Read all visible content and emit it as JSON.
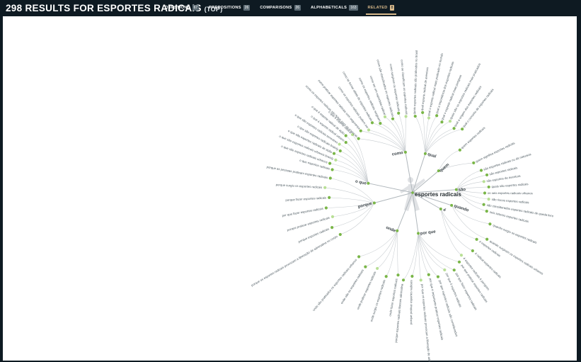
{
  "header": {
    "count": "298",
    "title_text": "RESULTS FOR ESPORTES RADICAIS",
    "top_label": "(TOP)"
  },
  "tabs": [
    {
      "label": "QUESTIONS",
      "count": "67",
      "active": false
    },
    {
      "label": "PREPOSITIONS",
      "count": "26",
      "active": false
    },
    {
      "label": "COMPARISONS",
      "count": "26",
      "active": false
    },
    {
      "label": "ALPHABETICALS",
      "count": "163",
      "active": false
    },
    {
      "label": "RELATED",
      "count": "8",
      "active": true
    }
  ],
  "colors": {
    "dark_bg": "#0e1a22",
    "accent": "#d7b88a",
    "dot_green": "#7ab648",
    "dot_light": "#b8df95"
  },
  "wheel": {
    "center_label": "esportes radicais",
    "center_icon": "person-silhouette-icon",
    "branches": [
      {
        "label": "como",
        "items": [
          "como os esportes radicais são feitos para as crianças",
          "como praticar esportes radicais com segurança",
          "como os esportes radicais podem ser",
          "como se tornar atleta de esportes radicais",
          "como os esportes radicais surgiram",
          "como ser um esportista radical",
          "como são classificados os esportes radicais",
          "como surgiram os esportes radicais",
          "como se classificam os esportes radicais"
        ]
      },
      {
        "label": "qual",
        "items": [
          "quais esportes radicais são praticados no brasil",
          "qual esporte radical de aventura",
          "qual o esporte radical mais praticado no mundo",
          "qual a importância dos esportes radicais",
          "qual o esporte radical mais perigoso",
          "quais são os esportes radicais mais praticados",
          "qual a origem dos esportes radicais",
          "qual o conceito de esportes radicais"
        ]
      },
      {
        "label": "quem",
        "items": [
          "quem esportes radicais",
          "quem significa esportes radicais"
        ]
      },
      {
        "label": "são",
        "items": [
          "são esportes radicais ou da natureza",
          "são esportes radicais",
          "são esportes de aventura",
          "quais são esportes radicais",
          "os seis esportes radicais urbanos",
          "são riscos esportes radicais",
          "são considerados esportes radicais de queda livre",
          "seis setores esportes radicais"
        ]
      },
      {
        "label": "quando",
        "items": [
          "quando surgiu os esportes radicais",
          "quando surgiram os esportes radicais urbanos"
        ]
      },
      {
        "label": "é",
        "items": [
          "é esportes radicais",
          "é radical esportes radicais",
          "é esportes radicais é perigoso"
        ]
      },
      {
        "label": "por que",
        "items": [
          "por que praticar esportes radicais",
          "por que fazer esportes radicais",
          "por que é esportes radicais",
          "por que esportes radicais são considerados",
          "por que é importante praticar esportes radicais",
          "por que os esportes radicais provocam a liberação de adrenalina",
          "porque praticar esportes radicais",
          "porque esportes radicais liberam adrenalina"
        ]
      },
      {
        "label": "onde",
        "items": [
          "onde fazer esportes radicais",
          "onde surgiu os esportes radicais",
          "onde praticar esportes radicais",
          "onde são os esportes radicais",
          "onde são praticados os esportes radicais urbanos"
        ]
      },
      {
        "label": "porque",
        "items": [
          "porque os esportes radicais provocam a liberação de adrenalina no corpo",
          "porque esportes radicais",
          "porque praticar esportes radicais",
          "por que fazer esportes radicais",
          "porque fazer esportes radicais",
          "porque surgiu os esportes radicais",
          "porque as pessoas praticam esportes radicais"
        ]
      },
      {
        "label": "o que",
        "items": [
          "o que esportes radicais",
          "o que são esportes radicais urbanos",
          "o que são esportes radicais urbanos brainly",
          "o que são esportes radicais de ação",
          "o que são esportes radicais brainly",
          "o que são esportes radicais terrestres",
          "o que é esporte radical urbano",
          "o que é esporte radical de ação",
          "o que é esporte radical"
        ]
      }
    ]
  }
}
